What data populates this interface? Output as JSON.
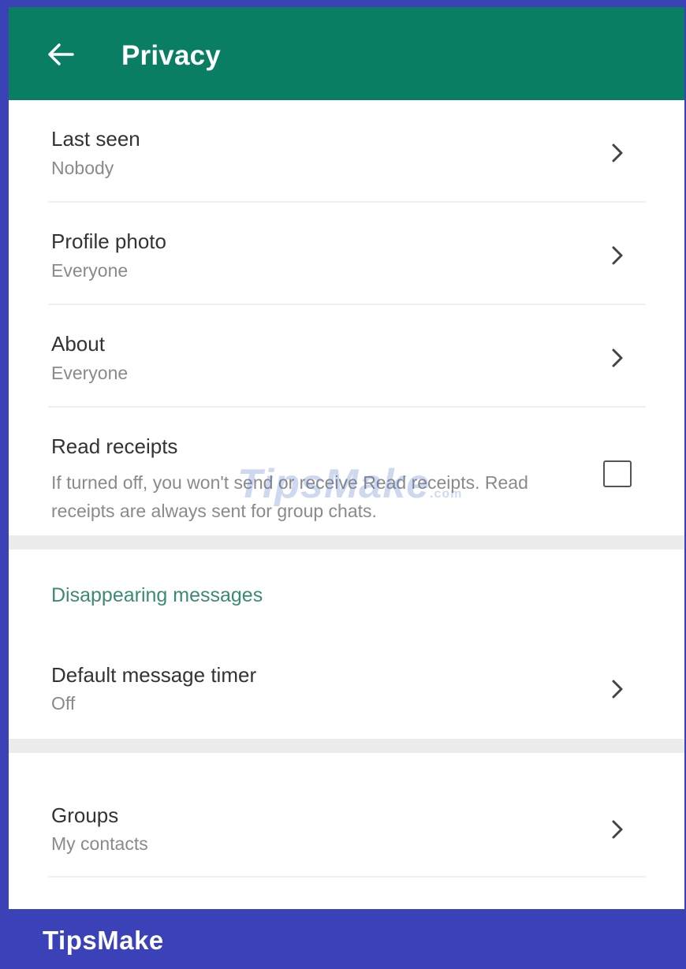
{
  "header": {
    "title": "Privacy",
    "back_icon": "arrow-left-icon"
  },
  "rows": [
    {
      "title": "Last seen",
      "value": "Nobody"
    },
    {
      "title": "Profile photo",
      "value": "Everyone"
    },
    {
      "title": "About",
      "value": "Everyone"
    }
  ],
  "read_receipts": {
    "title": "Read receipts",
    "description": "If turned off, you won't send or receive Read receipts. Read receipts are always sent for group chats.",
    "checked": false
  },
  "disappearing": {
    "section_title": "Disappearing messages",
    "timer_title": "Default message timer",
    "timer_value": "Off"
  },
  "groups": {
    "title": "Groups",
    "value": "My contacts"
  },
  "watermark": {
    "center_text": "TipsMake",
    "center_suffix": ".com",
    "footer_brand": "TipsMake"
  },
  "colors": {
    "appbar": "#0a7e63",
    "accent_section": "#3b8a76",
    "frame_border": "#3b42b8"
  }
}
